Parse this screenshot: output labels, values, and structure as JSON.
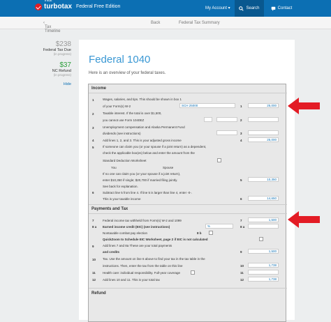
{
  "header": {
    "brand_intuit": "intuit",
    "brand_name": "turbotax",
    "edition": "Federal Free Edition",
    "my_account": "My Account ▾",
    "search": "Search",
    "contact": "Contact"
  },
  "subnav": {
    "back_timeline": "Tax Timeline",
    "back": "Back",
    "summary": "Federal Tax Summary"
  },
  "sidebar": {
    "federal_amount": "$238",
    "federal_label": "Federal Tax Due",
    "federal_status": "(in progress)",
    "state_amount": "$37",
    "state_label": "NC Refund",
    "state_status": "(in progress)",
    "hide": "Hide"
  },
  "main": {
    "title": "Federal 1040",
    "intro": "Here is an overview of your federal taxes."
  },
  "form": {
    "income_heading": "Income",
    "payments_heading": "Payments and Tax",
    "refund_heading": "Refund",
    "l1a": "Wages, salaries, and tips. This should be shown in box 1",
    "l1b": "of your Form(s) W-2",
    "l1_sch": "SCH 25000",
    "l1_val": "25,000",
    "l2a": "Taxable interest. If the total is over $1,500,",
    "l2b": "you cannot use Form 1040EZ",
    "l3a": "Unemployment compensation and Alaska Permanent Fund",
    "l3b": "dividends (see instructions)",
    "l4": "Add lines 1, 2, and 3. This is your adjusted gross income",
    "l4_val": "25,000",
    "l5a": "If someone can claim you (or your spouse if a joint return) as a dependent,",
    "l5b": "check the applicable box(es) below and enter the amount from the",
    "l5c": "Standard Deduction Worksheet",
    "l5_you": "You",
    "l5_spouse": "Spouse",
    "l5d": "If no one can claim you (or your spouse if a joint return),",
    "l5e": "enter $10,350 if single; $20,700 if married filing jointly.",
    "l5f": "See back for explanation.",
    "l5_val": "10,350",
    "l6a": "Subtract line 5 from line 4. If line 5 is larger than line 4, enter -0-.",
    "l6b": "This is your taxable income",
    "l6_val": "14,650",
    "l7": "Federal income tax withheld from Form(s) W-2 and 1099",
    "l7_val": "1,500",
    "l8a": "Earned income credit (EIC) (see instructions)",
    "l8a_pct": "%",
    "l8b": "Nontaxable combat pay election",
    "l8b_box": "8 b",
    "l8c": "QuickZoom to Schedule EIC Worksheet, page 2 if EIC is not calculated",
    "l9a": "Add lines 7 and 8a These are your total payments",
    "l9b": "and credits",
    "l9_val": "1,500",
    "l10a": "Tax. Use the amount on line 6 above to find your tax in the tax table in the",
    "l10b": "instructions. Then, enter the tax from the table on this line",
    "l10_val": "1,738",
    "l11a": "Health care: individual responsibility. Full-year coverage",
    "l12": "Add lines 10 and 11. This is your total tax",
    "l12_val": "1,738"
  },
  "colors": {
    "header_blue": "#0c6fb3",
    "title_blue": "#3a98d4",
    "refund_green": "#2d9e3c",
    "arrow_red": "#e31c25"
  }
}
